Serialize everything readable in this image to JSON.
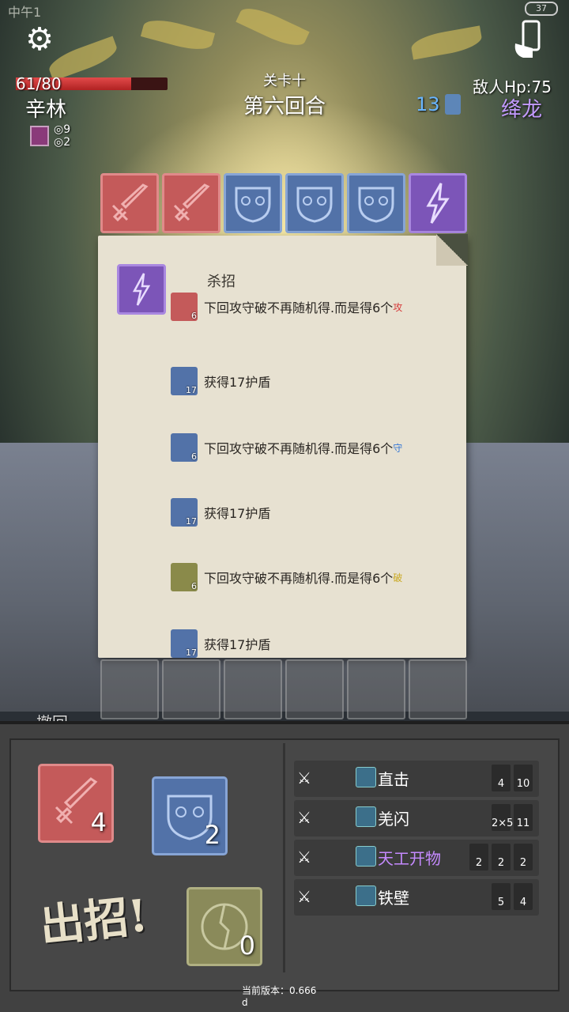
{
  "status_bar": {
    "left": "中午1",
    "battery": "37"
  },
  "player": {
    "hp": "61/80",
    "hp_fraction": 0.76,
    "name": "辛林",
    "stat_a": "9",
    "stat_b": "2"
  },
  "stage": {
    "level": "关卡十",
    "round": "第六回合"
  },
  "enemy": {
    "hp": "敌人Hp:75",
    "shield": "13",
    "name": "绛龙"
  },
  "tiles": [
    {
      "kind": "sword",
      "color": "red"
    },
    {
      "kind": "sword",
      "color": "red"
    },
    {
      "kind": "mask",
      "color": "blue"
    },
    {
      "kind": "mask",
      "color": "blue"
    },
    {
      "kind": "mask",
      "color": "blue"
    },
    {
      "kind": "lightning",
      "color": "purple"
    }
  ],
  "tooltip": {
    "title": "杀招",
    "lines": [
      {
        "icon": "sword-icon",
        "badge": "6",
        "text": "下回攻守破不再随机得.而是得6个",
        "tag": "攻",
        "tag_color": "#d63a3a"
      },
      {
        "icon": "shield-icon",
        "badge": "17",
        "text": "获得17护盾",
        "tag": "",
        "tag_color": ""
      },
      {
        "icon": "mask-icon",
        "badge": "6",
        "text": "下回攻守破不再随机得.而是得6个",
        "tag": "守",
        "tag_color": "#3a7ad6"
      },
      {
        "icon": "shield-icon",
        "badge": "17",
        "text": "获得17护盾",
        "tag": "",
        "tag_color": ""
      },
      {
        "icon": "broken-disc-icon",
        "badge": "6",
        "text": "下回攻守破不再随机得.而是得6个",
        "tag": "破",
        "tag_color": "#c9a81e"
      },
      {
        "icon": "shield-icon",
        "badge": "17",
        "text": "获得17护盾",
        "tag": "",
        "tag_color": ""
      }
    ]
  },
  "controls": {
    "undo": "撤回",
    "attack_count": "4",
    "defense_count": "2",
    "break_count": "0",
    "execute": "出招!"
  },
  "skills": [
    {
      "name": "直击",
      "name_color": "#ffffff",
      "stats": [
        "4",
        "10"
      ]
    },
    {
      "name": "羌闪",
      "name_color": "#ffffff",
      "stats": [
        "2×5",
        "11"
      ]
    },
    {
      "name": "天工开物",
      "name_color": "#c58aff",
      "stats": [
        "2",
        "2",
        "2"
      ]
    },
    {
      "name": "铁壁",
      "name_color": "#ffffff",
      "stats": [
        "5",
        "4"
      ]
    }
  ],
  "version": {
    "label": "当前版本：0.666",
    "suffix": "d"
  },
  "colors": {
    "attack": "#c45a5a",
    "defense": "#5272a8",
    "special": "#7c55b8",
    "break": "#8a8a5a"
  }
}
